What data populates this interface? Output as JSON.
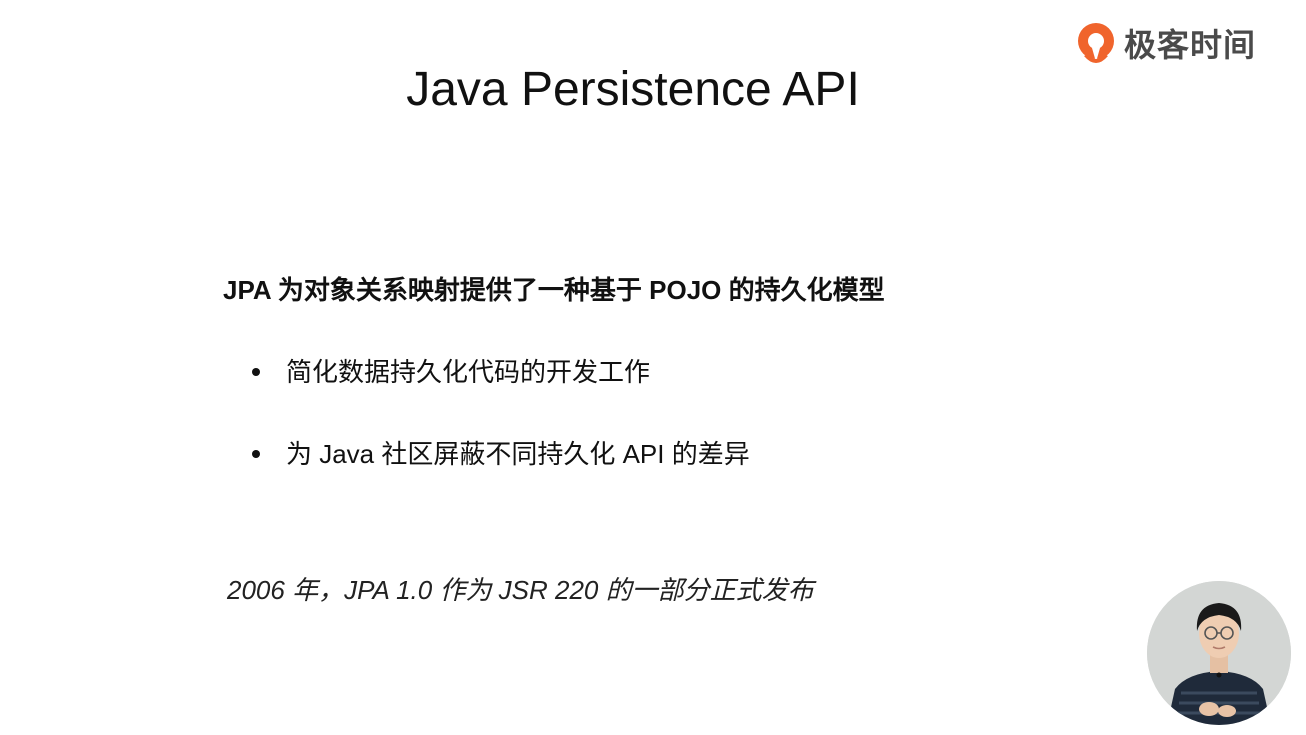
{
  "brand": {
    "logo_text": "极客时间",
    "logo_icon": "geektime-logo-icon",
    "accent_color": "#f0642c"
  },
  "slide": {
    "title": "Java Persistence API",
    "headline": "JPA 为对象关系映射提供了一种基于 POJO 的持久化模型",
    "bullets": [
      {
        "text": "简化数据持久化代码的开发工作"
      },
      {
        "text": "为 Java 社区屏蔽不同持久化 API 的差异"
      }
    ],
    "footnote": "2006 年，JPA 1.0 作为 JSR 220 的一部分正式发布"
  },
  "presenter": {
    "video_icon": "presenter-video"
  }
}
